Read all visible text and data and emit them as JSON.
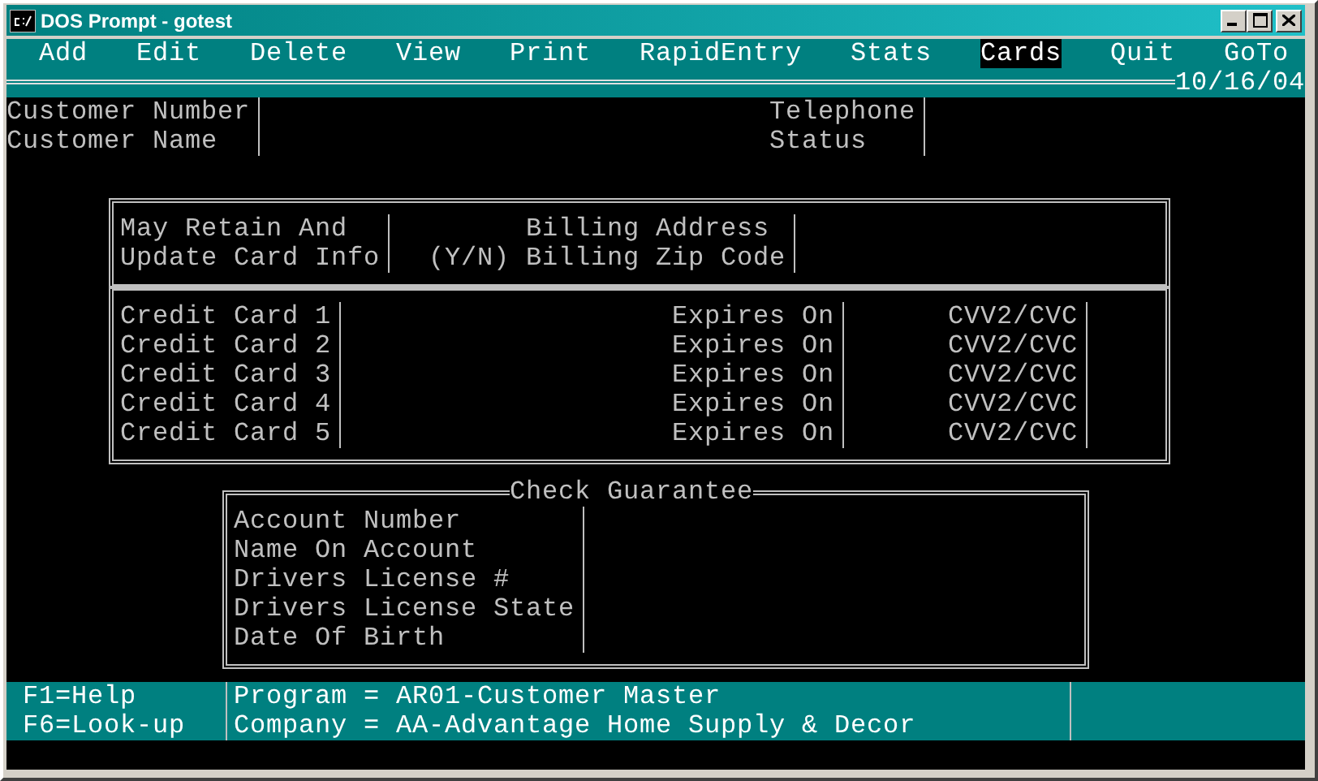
{
  "window": {
    "title": "DOS Prompt - gotest"
  },
  "menu": [
    {
      "label": "Add",
      "selected": false
    },
    {
      "label": "Edit",
      "selected": false
    },
    {
      "label": "Delete",
      "selected": false
    },
    {
      "label": "View",
      "selected": false
    },
    {
      "label": "Print",
      "selected": false
    },
    {
      "label": "RapidEntry",
      "selected": false
    },
    {
      "label": "Stats",
      "selected": false
    },
    {
      "label": "Cards",
      "selected": true
    },
    {
      "label": "Quit",
      "selected": false
    },
    {
      "label": "GoTo",
      "selected": false
    }
  ],
  "date": "10/16/04",
  "customer_header": {
    "left_labels": [
      "Customer Number",
      "Customer Name"
    ],
    "right_labels": [
      "Telephone",
      "Status"
    ]
  },
  "card_info": {
    "retain_labels": [
      "May Retain And",
      "Update Card Info"
    ],
    "yn_label": "(Y/N)",
    "billing_labels": [
      "Billing Address",
      "Billing Zip Code"
    ]
  },
  "credit_cards": [
    {
      "label": "Credit Card 1",
      "expires_label": "Expires On",
      "cvv_label": "CVV2/CVC"
    },
    {
      "label": "Credit Card 2",
      "expires_label": "Expires On",
      "cvv_label": "CVV2/CVC"
    },
    {
      "label": "Credit Card 3",
      "expires_label": "Expires On",
      "cvv_label": "CVV2/CVC"
    },
    {
      "label": "Credit Card 4",
      "expires_label": "Expires On",
      "cvv_label": "CVV2/CVC"
    },
    {
      "label": "Credit Card 5",
      "expires_label": "Expires On",
      "cvv_label": "CVV2/CVC"
    }
  ],
  "check_guarantee": {
    "title": "Check Guarantee",
    "fields": [
      "Account Number",
      "Name On Account",
      "Drivers License #",
      "Drivers License State",
      "Date Of Birth"
    ]
  },
  "status_bar": {
    "keys": [
      "F1=Help",
      "F6=Look-up"
    ],
    "info": [
      "Program = AR01-Customer Master",
      "Company = AA-Advantage Home Supply & Decor"
    ]
  }
}
